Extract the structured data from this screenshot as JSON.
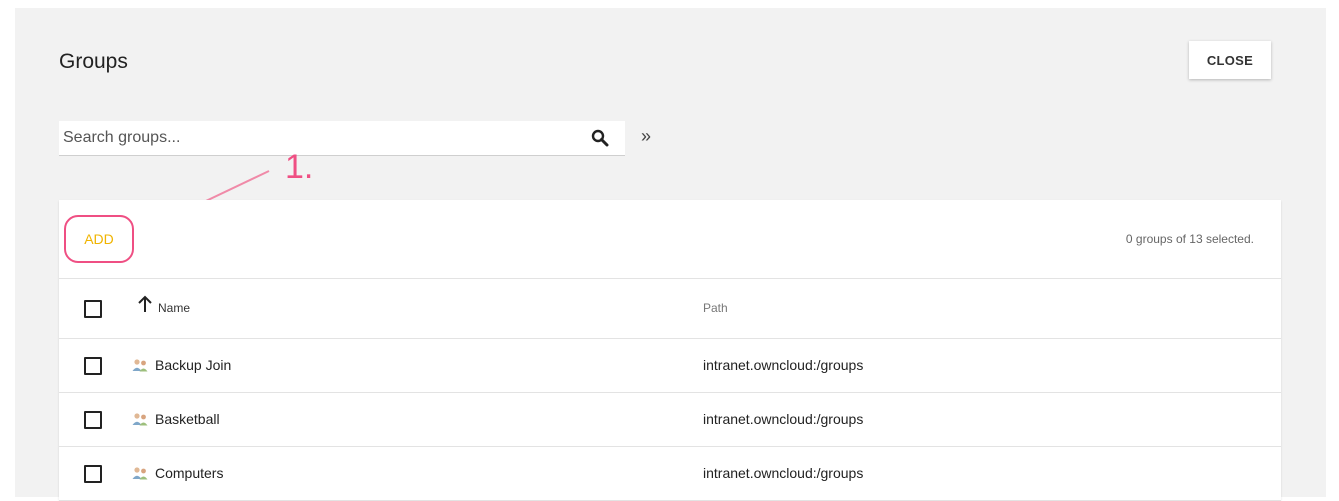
{
  "header": {
    "title": "Groups",
    "close_label": "CLOSE"
  },
  "search": {
    "placeholder": "Search groups...",
    "value": "",
    "expand_glyph": "»"
  },
  "annotation": {
    "label": "1.",
    "color": "#ef4f83"
  },
  "toolbar": {
    "add_label": "ADD",
    "add_color": "#f0b400",
    "selection_text": "0 groups of 13 selected."
  },
  "table": {
    "columns": [
      "Name",
      "Path"
    ],
    "rows": [
      {
        "name": "Backup Join",
        "path": "intranet.owncloud:/groups"
      },
      {
        "name": "Basketball",
        "path": "intranet.owncloud:/groups"
      },
      {
        "name": "Computers",
        "path": "intranet.owncloud:/groups"
      }
    ]
  },
  "icons": {
    "search": "search-icon",
    "sort": "arrow-up-icon",
    "group": "group-icon",
    "expand": "double-chevron-right-icon"
  }
}
